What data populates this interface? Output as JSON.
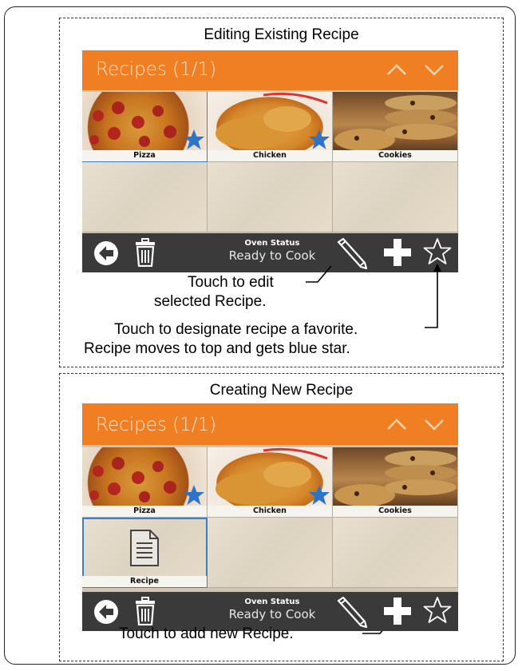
{
  "sections": [
    {
      "title": "Editing Existing Recipe",
      "header_title": "Recipes (1/1)",
      "tiles": [
        {
          "label": "Pizza",
          "image": "pizza",
          "favorite": true,
          "selected": true
        },
        {
          "label": "Chicken",
          "image": "chicken",
          "favorite": true,
          "selected": false
        },
        {
          "label": "Cookies",
          "image": "cookies",
          "favorite": false,
          "selected": false
        }
      ],
      "footer": {
        "status_title": "Oven Status",
        "status_value": "Ready to Cook"
      },
      "callouts": {
        "edit": [
          "Touch to edit",
          "selected Recipe."
        ],
        "favorite": [
          "Touch to designate recipe a favorite.",
          "Recipe moves to top and gets blue star."
        ]
      }
    },
    {
      "title": "Creating New Recipe",
      "header_title": "Recipes (1/1)",
      "tiles": [
        {
          "label": "Pizza",
          "image": "pizza",
          "favorite": true,
          "selected": false
        },
        {
          "label": "Chicken",
          "image": "chicken",
          "favorite": true,
          "selected": false
        },
        {
          "label": "Cookies",
          "image": "cookies",
          "favorite": false,
          "selected": false
        },
        {
          "label": "Recipe",
          "image": "document-icon",
          "favorite": false,
          "selected": true
        }
      ],
      "footer": {
        "status_title": "Oven Status",
        "status_value": "Ready to Cook"
      },
      "callouts": {
        "add": "Touch to add new Recipe."
      }
    }
  ],
  "icons": {
    "back": "back-arrow-icon",
    "delete": "trash-icon",
    "edit": "pencil-icon",
    "add": "plus-icon",
    "favorite": "star-outline-icon",
    "page_up": "chevron-up-icon",
    "page_down": "chevron-down-icon",
    "favorite_badge": "blue-star-icon"
  },
  "colors": {
    "header": "#f07f24",
    "footer": "#3a3a3a",
    "selection": "#3d7dc2",
    "favorite_star": "#2f73c6"
  }
}
